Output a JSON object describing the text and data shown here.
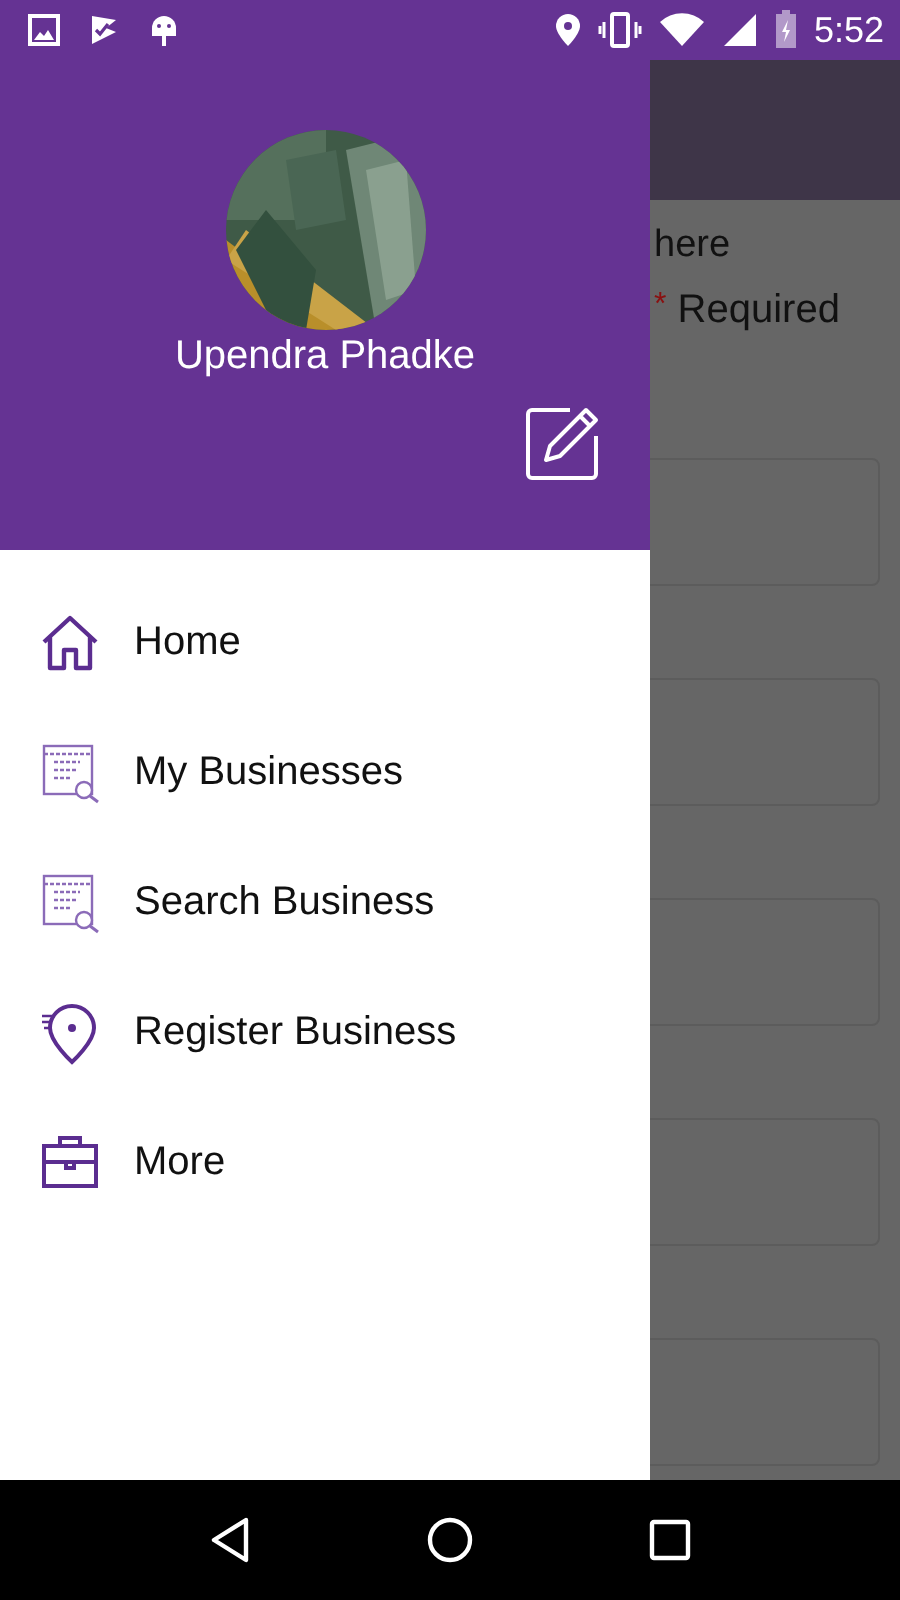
{
  "status_bar": {
    "time": "5:52"
  },
  "drawer": {
    "user_name": "Upendra Phadke",
    "items": [
      {
        "label": "Home",
        "kind": "home"
      },
      {
        "label": "My Businesses",
        "kind": "listing"
      },
      {
        "label": "Search Business",
        "kind": "listing"
      },
      {
        "label": "Register Business",
        "kind": "register"
      },
      {
        "label": "More",
        "kind": "more"
      }
    ]
  },
  "background_form": {
    "heading": "here",
    "required_mark": "*",
    "required_label": "Required",
    "fields": [
      {
        "kind": "input"
      },
      {
        "kind": "input"
      },
      {
        "kind": "input"
      },
      {
        "kind": "input"
      },
      {
        "kind": "input"
      }
    ]
  }
}
